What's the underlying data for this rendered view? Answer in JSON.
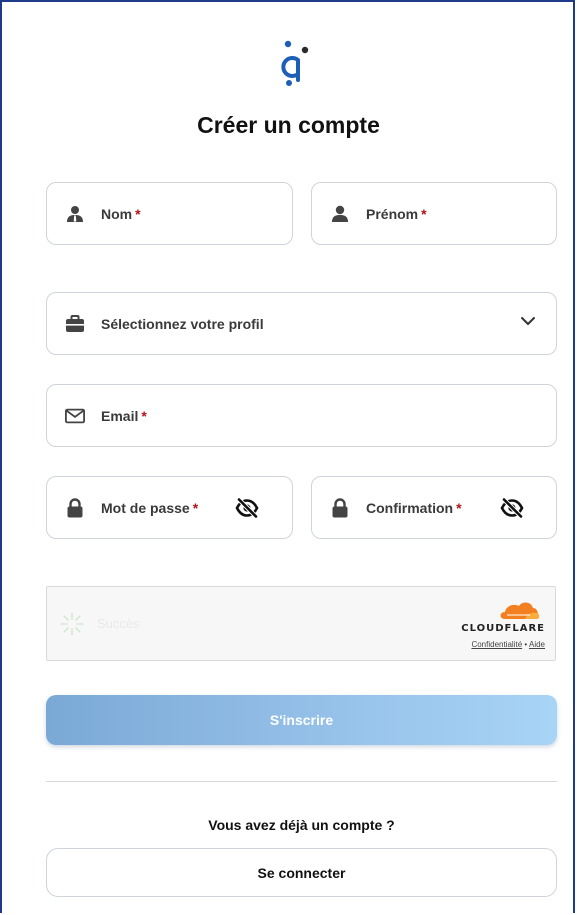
{
  "title": "Créer un compte",
  "fields": {
    "nom": {
      "label": "Nom",
      "required": "*"
    },
    "prenom": {
      "label": "Prénom",
      "required": "*"
    },
    "profil": {
      "label": "Sélectionnez votre profil"
    },
    "email": {
      "label": "Email",
      "required": "*"
    },
    "password": {
      "label": "Mot de passe",
      "required": "*"
    },
    "confirmation": {
      "label": "Confirmation",
      "required": "*"
    }
  },
  "captcha": {
    "status": "Succès",
    "brand": "CLOUDFLARE",
    "privacy_link": "Confidentialité",
    "separator": "•",
    "help_link": "Aide"
  },
  "submit_label": "S'inscrire",
  "already_text": "Vous avez déjà un compte ?",
  "login_label": "Se connecter",
  "colors": {
    "required": "#b3121b",
    "submit_start": "#7ba9d6",
    "submit_end": "#a8d4f6",
    "cloudflare": "#f38020",
    "logo_blue": "#1d5fb8"
  }
}
